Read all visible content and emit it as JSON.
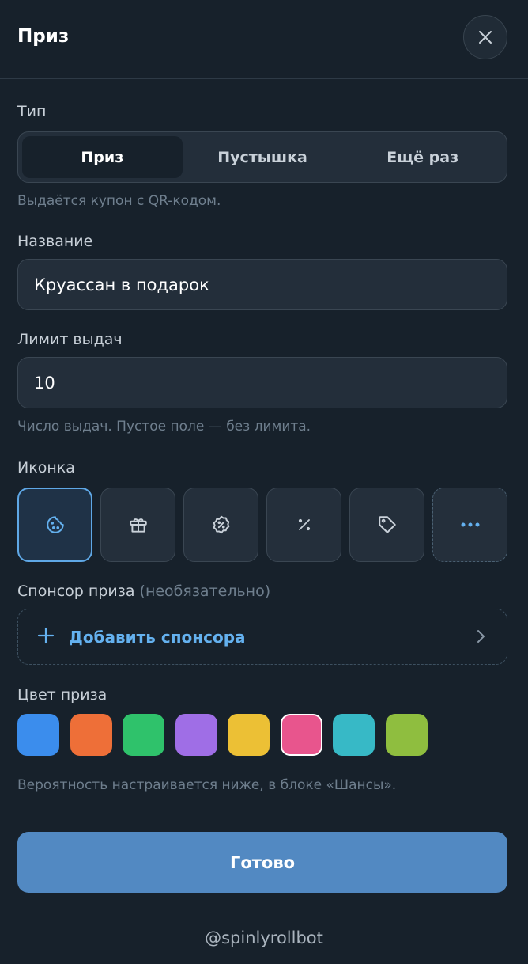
{
  "header": {
    "title": "Приз"
  },
  "type_section": {
    "label": "Тип",
    "options": [
      "Приз",
      "Пустышка",
      "Ещё раз"
    ],
    "selected": "Приз",
    "hint": "Выдаётся купон с QR-кодом."
  },
  "name_field": {
    "label": "Название",
    "value": "Круассан в подарок"
  },
  "limit_field": {
    "label": "Лимит выдач",
    "value": "10",
    "hint": "Число выдач. Пустое поле — без лимита."
  },
  "icon_section": {
    "label": "Иконка",
    "icons": [
      "cookie-icon",
      "gift-icon",
      "discount-badge-icon",
      "percent-icon",
      "tag-icon",
      "more-icon"
    ],
    "selected": "cookie-icon"
  },
  "sponsor": {
    "label": "Спонсор приза",
    "optional_note": "(необязательно)",
    "button_label": "Добавить спонсора"
  },
  "color_section": {
    "label": "Цвет приза",
    "colors": [
      "#3b8ded",
      "#ee6f38",
      "#2fc26b",
      "#9f6ee6",
      "#ecc035",
      "#e8558d",
      "#37b9c6",
      "#8fbe3f"
    ],
    "selected": "#e8558d",
    "hint": "Вероятность настраивается ниже, в блоке «Шансы»."
  },
  "done_button": {
    "label": "Готово"
  },
  "footer": {
    "text": "@spinlyrollbot"
  },
  "accent_color": "#64b1ef"
}
